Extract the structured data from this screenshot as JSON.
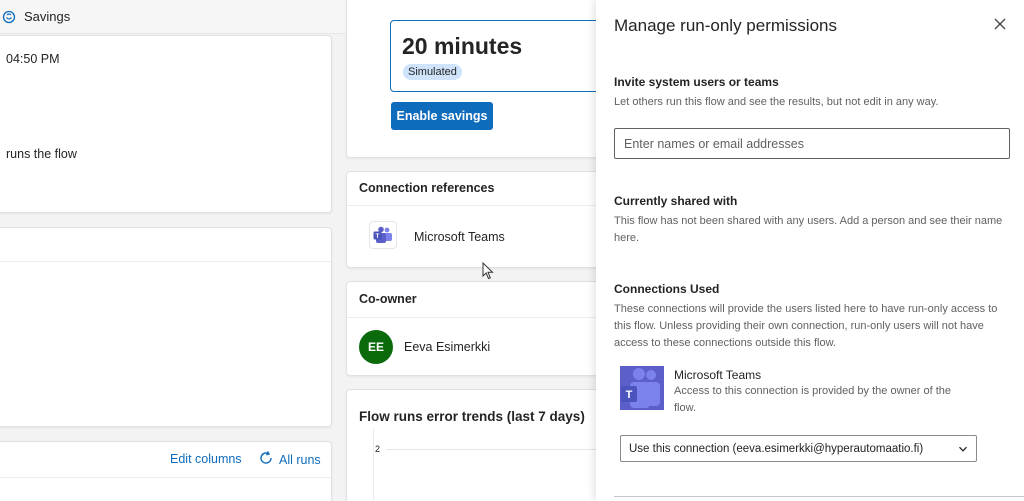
{
  "topbar": {
    "title": "Savings",
    "icon": "savings-icon"
  },
  "details": {
    "time_text": "04:50 PM",
    "runs_text": "runs the flow"
  },
  "runs_table": {
    "edit_columns": "Edit columns",
    "all_runs": "All runs"
  },
  "savings_card": {
    "minutes": "20 minutes",
    "badge": "Simulated",
    "enable_button": "Enable savings"
  },
  "connection_refs": {
    "title": "Connection references",
    "item": "Microsoft Teams"
  },
  "coowner": {
    "title": "Co-owner",
    "initials": "EE",
    "name": "Eeva Esimerkki",
    "avatar_color": "#0b6a0b"
  },
  "error_trends": {
    "title": "Flow runs error trends (last 7 days)",
    "tick_label": "2"
  },
  "panel": {
    "title": "Manage run-only permissions",
    "invite_heading": "Invite system users or teams",
    "invite_desc": "Let others run this flow and see the results, but not edit in any way.",
    "invite_placeholder": "Enter names or email addresses",
    "shared_heading": "Currently shared with",
    "shared_desc": "This flow has not been shared with any users. Add a person and see their name here.",
    "connections_heading": "Connections Used",
    "connections_desc": "These connections will provide the users listed here to have run-only access to this flow. Unless providing their own connection, run-only users will not have access to these connections outside this flow.",
    "connection_name": "Microsoft Teams",
    "connection_desc": "Access to this connection is provided by the owner of the flow.",
    "connection_select": "Use this connection (eeva.esimerkki@hyperautomaatio.fi)"
  },
  "colors": {
    "accent": "#0f6cbd",
    "badge_bg": "#cfe4fa",
    "teams_purple": "#5b5fc7"
  }
}
